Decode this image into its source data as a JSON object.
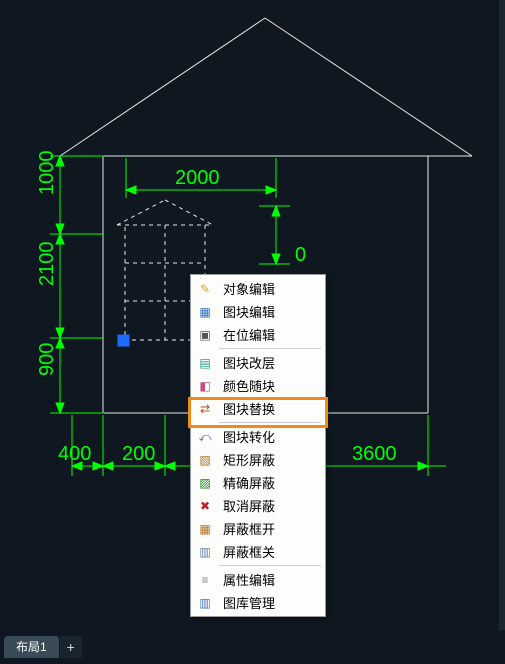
{
  "tabs": {
    "layout1": "布局1",
    "add": "+"
  },
  "dimensions": {
    "top_inner": "2000",
    "left_top": "1000",
    "left_mid": "2100",
    "left_bot": "900",
    "mid_top_right": "0",
    "bottom_left": "400",
    "bottom_mid": "200",
    "bottom_right": "3600"
  },
  "menu": {
    "items": [
      {
        "icon": "edit-icon",
        "label": "对象编辑"
      },
      {
        "icon": "block-edit-icon",
        "label": "图块编辑"
      },
      {
        "icon": "inplace-icon",
        "label": "在位编辑"
      },
      {
        "sep": true
      },
      {
        "icon": "layer-change-icon",
        "label": "图块改层"
      },
      {
        "icon": "color-random-icon",
        "label": "颜色随块"
      },
      {
        "icon": "block-replace-icon",
        "label": "图块替换",
        "highlight": true
      },
      {
        "sep": true
      },
      {
        "icon": "block-convert-icon",
        "label": "图块转化"
      },
      {
        "icon": "rect-mask-icon",
        "label": "矩形屏蔽"
      },
      {
        "icon": "precise-mask-icon",
        "label": "精确屏蔽"
      },
      {
        "icon": "cancel-mask-icon",
        "label": "取消屏蔽"
      },
      {
        "icon": "mask-on-icon",
        "label": "屏蔽框开"
      },
      {
        "icon": "mask-off-icon",
        "label": "屏蔽框关"
      },
      {
        "sep": true
      },
      {
        "icon": "attr-edit-icon",
        "label": "属性编辑"
      },
      {
        "icon": "library-icon",
        "label": "图库管理"
      }
    ]
  },
  "icons": {
    "edit-icon": {
      "glyph": "✎",
      "color": "#e0a020"
    },
    "block-edit-icon": {
      "glyph": "▦",
      "color": "#3070c0"
    },
    "inplace-icon": {
      "glyph": "▣",
      "color": "#555"
    },
    "layer-change-icon": {
      "glyph": "▤",
      "color": "#20a080"
    },
    "color-random-icon": {
      "glyph": "◧",
      "color": "#c05080"
    },
    "block-replace-icon": {
      "glyph": "⇄",
      "color": "#b05020"
    },
    "block-convert-icon": {
      "glyph": "⤺",
      "color": "#3070c0"
    },
    "rect-mask-icon": {
      "glyph": "▧",
      "color": "#b07020"
    },
    "precise-mask-icon": {
      "glyph": "▨",
      "color": "#208020"
    },
    "cancel-mask-icon": {
      "glyph": "✖",
      "color": "#c02020"
    },
    "mask-on-icon": {
      "glyph": "▦",
      "color": "#b07020"
    },
    "mask-off-icon": {
      "glyph": "▥",
      "color": "#6080a0"
    },
    "attr-edit-icon": {
      "glyph": "≡",
      "color": "#888"
    },
    "library-icon": {
      "glyph": "▥",
      "color": "#4070c0"
    }
  }
}
